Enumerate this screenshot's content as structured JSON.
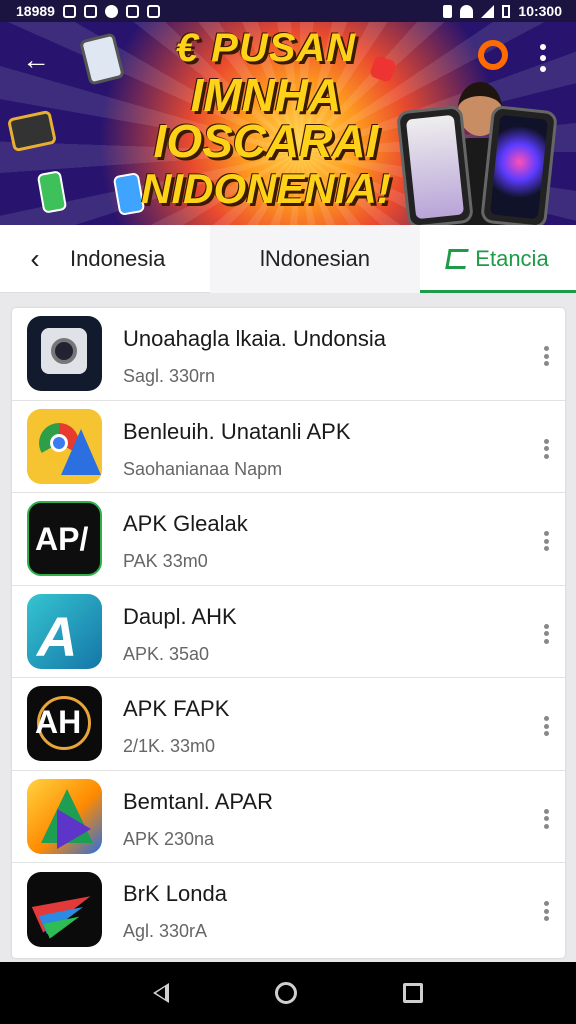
{
  "status_bar": {
    "time_left": "18989",
    "time_right": "10:300"
  },
  "banner": {
    "line1": "€ PUSAN",
    "line2": "IMNHA IOSCARAI",
    "line3": "NIDONENIA!"
  },
  "tabs": {
    "tab1": "Indonesia",
    "tab2": "lNdonesian",
    "tab3": "Etancia",
    "active_color": "#1e9b46"
  },
  "apps": [
    {
      "name": "Unoahagla lkaia. Undonsia",
      "sub": "Sagl. 330rn"
    },
    {
      "name": "Benleuih. Unatanli APK",
      "sub": "Saohanianaa Napm"
    },
    {
      "name": "APK Glealak",
      "sub": "PAK 33m0"
    },
    {
      "name": "Daupl. AHK",
      "sub": "APK. 35a0"
    },
    {
      "name": "APK FAPK",
      "sub": "2/1K. 33m0"
    },
    {
      "name": "Bemtanl. APAR",
      "sub": "APK 230na"
    },
    {
      "name": "BrK Londa",
      "sub": "Agl. 330rA"
    }
  ],
  "icons": {
    "app1": "camera-icon",
    "app2": "chrome-map-icon",
    "app3": "apk-text-icon",
    "app4": "letter-a-icon",
    "app5": "apk-logo-icon",
    "app6": "colorful-triangle-icon",
    "app7": "paper-plane-icon"
  }
}
